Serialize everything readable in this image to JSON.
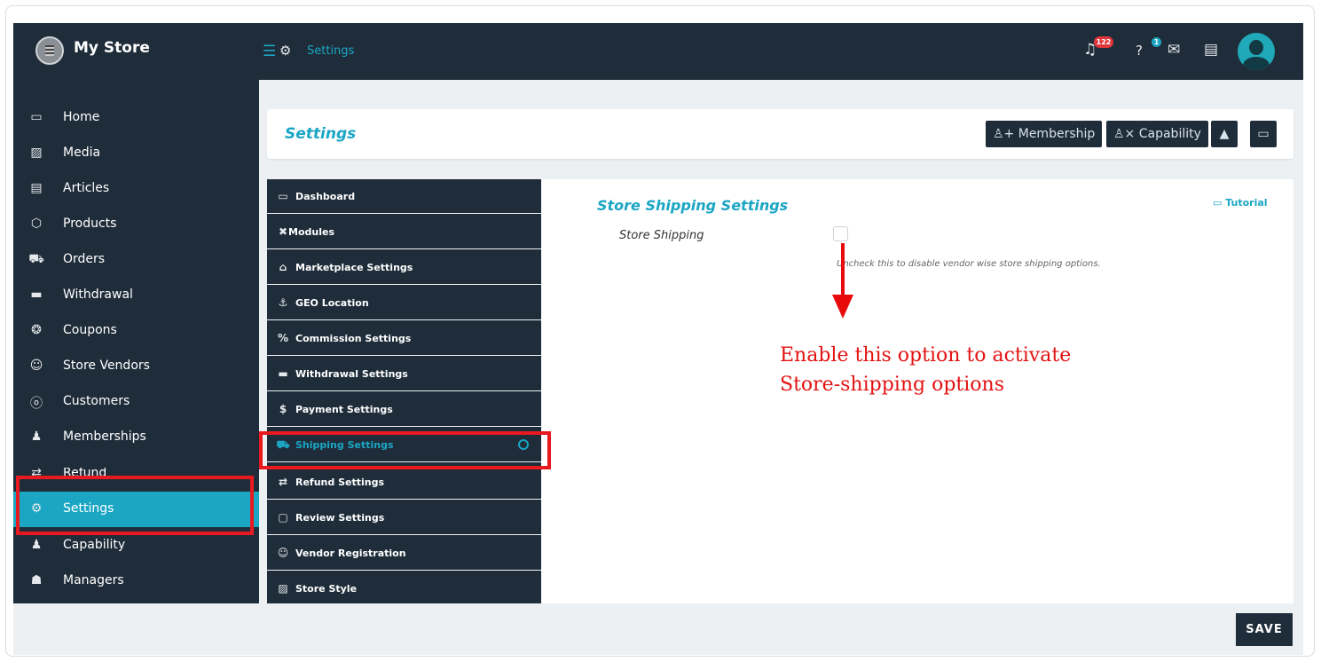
{
  "app": {
    "store_name": "My Store"
  },
  "topbar": {
    "breadcrumb": "Settings",
    "notification_count": "122",
    "help_count": "1"
  },
  "sidebar": {
    "items": [
      {
        "label": "Home",
        "icon": "▭"
      },
      {
        "label": "Media",
        "icon": "▨"
      },
      {
        "label": "Articles",
        "icon": "▤"
      },
      {
        "label": "Products",
        "icon": "⬡"
      },
      {
        "label": "Orders",
        "icon": "⛟"
      },
      {
        "label": "Withdrawal",
        "icon": "▬"
      },
      {
        "label": "Coupons",
        "icon": "❂"
      },
      {
        "label": "Store Vendors",
        "icon": "☺"
      },
      {
        "label": "Customers",
        "icon": "ⓞ"
      },
      {
        "label": "Memberships",
        "icon": "♟"
      },
      {
        "label": "Refund",
        "icon": "⇄"
      },
      {
        "label": "Settings",
        "icon": "⚙"
      },
      {
        "label": "Capability",
        "icon": "♟"
      },
      {
        "label": "Managers",
        "icon": "☗"
      }
    ]
  },
  "header": {
    "title": "Settings",
    "membership_label": "Membership",
    "capability_label": "Capability"
  },
  "submenu": {
    "items": [
      {
        "label": "Dashboard",
        "icon": "▭"
      },
      {
        "label": "Modules",
        "icon": "✖"
      },
      {
        "label": "Marketplace Settings",
        "icon": "⌂"
      },
      {
        "label": "GEO Location",
        "icon": "⚓"
      },
      {
        "label": "Commission Settings",
        "icon": "%"
      },
      {
        "label": "Withdrawal Settings",
        "icon": "▬"
      },
      {
        "label": "Payment Settings",
        "icon": "$"
      },
      {
        "label": "Shipping Settings",
        "icon": "⛟"
      },
      {
        "label": "Refund Settings",
        "icon": "⇄"
      },
      {
        "label": "Review Settings",
        "icon": "▢"
      },
      {
        "label": "Vendor Registration",
        "icon": "☺"
      },
      {
        "label": "Store Style",
        "icon": "▨"
      }
    ]
  },
  "content": {
    "section_title": "Store Shipping Settings",
    "tutorial_label": "Tutorial",
    "field_label": "Store Shipping",
    "help_text": "Uncheck this to disable vendor wise store shipping options.",
    "annotation_line1": "Enable this option to activate",
    "annotation_line2": "Store-shipping options"
  },
  "footer": {
    "save_label": "SAVE"
  },
  "colors": {
    "accent": "#1ba6c4",
    "dark": "#1f2d3a",
    "highlight": "#e8191f"
  }
}
